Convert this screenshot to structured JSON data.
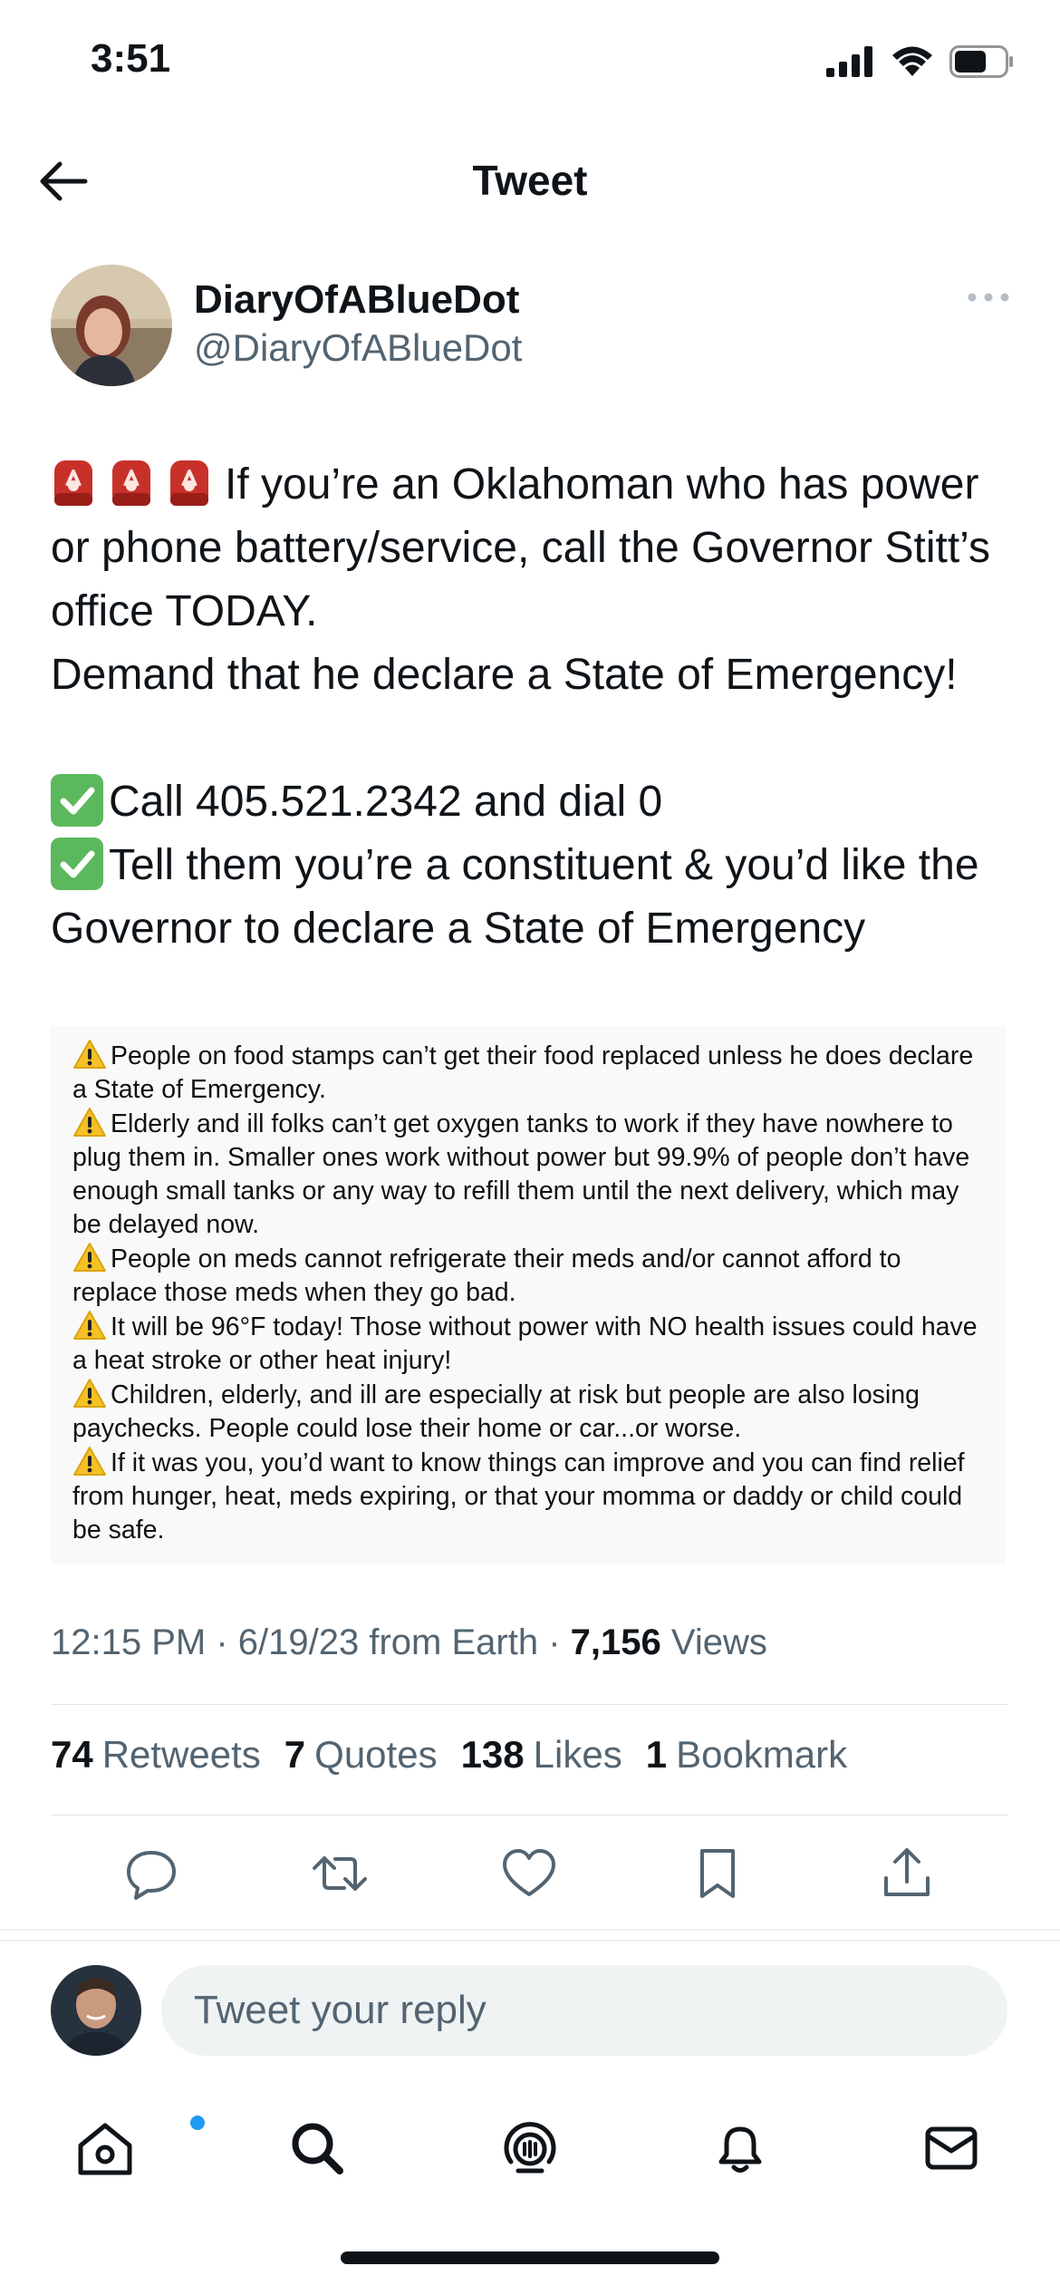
{
  "status_bar": {
    "time": "3:51"
  },
  "header": {
    "title": "Tweet"
  },
  "author": {
    "display_name": "DiaryOfABlueDot",
    "handle": "@DiaryOfABlueDot"
  },
  "tweet": {
    "line1": "If you’re an Oklahoman who has power or phone battery/service, call the Governor Stitt’s office TODAY.",
    "line2": "Demand that he declare a State of Emergency!",
    "check1": "Call 405.521.2342 and dial 0",
    "check2": "Tell them you’re a constituent & you’d like the Governor to declare a State of Emergency"
  },
  "media": {
    "items": [
      "People on food stamps can’t get their food replaced unless he does declare a State of Emergency.",
      "Elderly and ill folks can’t get oxygen tanks to work if they have nowhere to plug them in. Smaller ones work without power but 99.9% of people don’t have enough small tanks or any way to refill them until the next delivery, which may be delayed now.",
      "People on meds cannot refrigerate their meds and/or cannot afford to replace those meds when they go bad.",
      "It will be 96°F today! Those without power with NO health issues could have a heat stroke or other heat injury!",
      "Children, elderly, and ill are especially at risk but people are also losing paychecks. People could lose their home or car...or worse.",
      "If it was you, you’d want to know things can improve and you can find relief from hunger, heat, meds expiring, or that your momma or daddy or child could be safe."
    ]
  },
  "meta": {
    "time": "12:15 PM",
    "date": "6/19/23",
    "source": "from Earth",
    "views_count": "7,156",
    "views_label": "Views"
  },
  "stats": {
    "retweets_count": "74",
    "retweets_label": "Retweets",
    "quotes_count": "7",
    "quotes_label": "Quotes",
    "likes_count": "138",
    "likes_label": "Likes",
    "bookmarks_count": "1",
    "bookmarks_label": "Bookmark"
  },
  "reply": {
    "placeholder": "Tweet your reply"
  },
  "icons": {
    "actions": [
      "reply-icon",
      "retweet-icon",
      "like-icon",
      "bookmark-icon",
      "share-icon"
    ],
    "tabs": [
      "home-icon",
      "search-icon",
      "spaces-icon",
      "notifications-icon",
      "messages-icon"
    ]
  },
  "colors": {
    "accent": "#1d9bf0",
    "muted": "#536471",
    "text": "#0f1419"
  }
}
